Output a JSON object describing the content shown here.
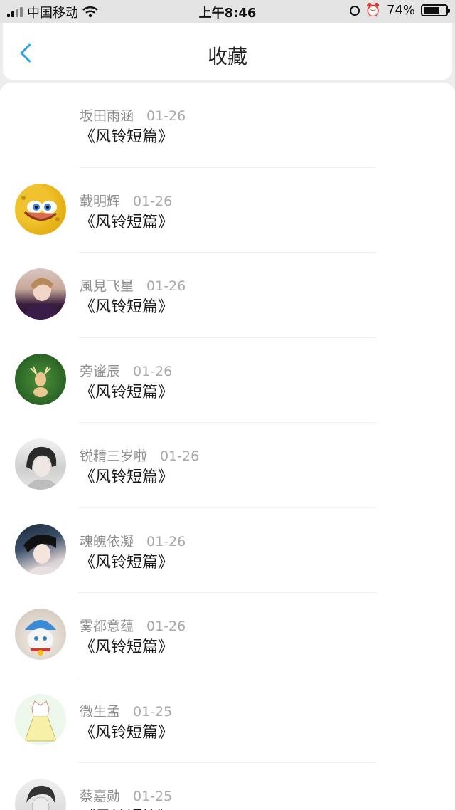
{
  "status_bar": {
    "carrier": "中国移动",
    "time": "上午8:46",
    "battery_percent": "74%",
    "battery_level": 0.74
  },
  "header": {
    "back_icon": "chevron-left-icon",
    "title": "收藏",
    "accent_color": "#2aa3e8"
  },
  "favorites": [
    {
      "user": "坂田雨涵",
      "date": "01-26",
      "title": "《风铃短篇》",
      "avatar": "none"
    },
    {
      "user": "载明辉",
      "date": "01-26",
      "title": "《风铃短篇》",
      "avatar": "cartoon-sponge"
    },
    {
      "user": "風見飞星",
      "date": "01-26",
      "title": "《风铃短篇》",
      "avatar": "person-purple"
    },
    {
      "user": "旁谧辰",
      "date": "01-26",
      "title": "《风铃短篇》",
      "avatar": "deer-green"
    },
    {
      "user": "锐精三岁啦",
      "date": "01-26",
      "title": "《风铃短篇》",
      "avatar": "person-gray"
    },
    {
      "user": "魂魄依凝",
      "date": "01-26",
      "title": "《风铃短篇》",
      "avatar": "person-dark"
    },
    {
      "user": "雾都意蕴",
      "date": "01-26",
      "title": "《风铃短篇》",
      "avatar": "cat-blue-hat"
    },
    {
      "user": "微生孟",
      "date": "01-25",
      "title": "《风铃短篇》",
      "avatar": "dress-sketch"
    },
    {
      "user": "蔡嘉勋",
      "date": "01-25",
      "title": "《风铃短篇》",
      "avatar": "person-bw"
    }
  ]
}
